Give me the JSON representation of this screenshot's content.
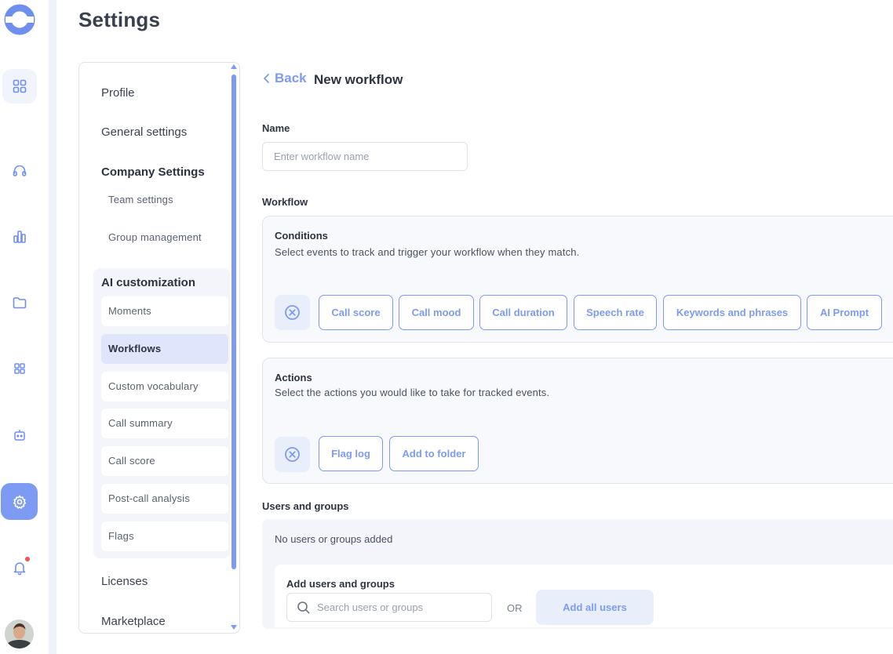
{
  "app": {
    "page_title": "Settings",
    "colors": {
      "accent": "#7d9bf2",
      "notification_dot": "#f05454"
    }
  },
  "rail": {
    "items": [
      {
        "icon": "dashboard-icon"
      },
      {
        "icon": "headset-icon"
      },
      {
        "icon": "chart-icon"
      },
      {
        "icon": "folder-icon"
      },
      {
        "icon": "apps-icon"
      },
      {
        "icon": "bot-icon"
      },
      {
        "icon": "gear-icon",
        "active": true
      },
      {
        "icon": "bell-icon",
        "notification": true
      }
    ]
  },
  "settings_nav": {
    "profile": "Profile",
    "general": "General settings",
    "company_heading": "Company Settings",
    "team_settings": "Team settings",
    "group_management": "Group management",
    "ai_heading": "AI customization",
    "ai_items": [
      "Moments",
      "Workflows",
      "Custom vocabulary",
      "Call summary",
      "Call score",
      "Post-call analysis",
      "Flags"
    ],
    "selected": "Workflows",
    "licenses": "Licenses",
    "marketplace": "Marketplace"
  },
  "main": {
    "back_label": "Back",
    "title": "New workflow",
    "name_label": "Name",
    "name_placeholder": "Enter workflow name",
    "workflow_label": "Workflow",
    "conditions": {
      "title": "Conditions",
      "description": "Select events to track and trigger your workflow when they match.",
      "chips": [
        "Call score",
        "Call mood",
        "Call duration",
        "Speech rate",
        "Keywords and phrases",
        "AI Prompt"
      ]
    },
    "actions": {
      "title": "Actions",
      "description": "Select the actions you would like to take for tracked events.",
      "chips": [
        "Flag log",
        "Add to folder"
      ]
    },
    "users": {
      "label": "Users and groups",
      "empty": "No users or groups added",
      "add_title": "Add users and groups",
      "search_placeholder": "Search users or groups",
      "or": "OR",
      "add_all": "Add all users"
    }
  }
}
